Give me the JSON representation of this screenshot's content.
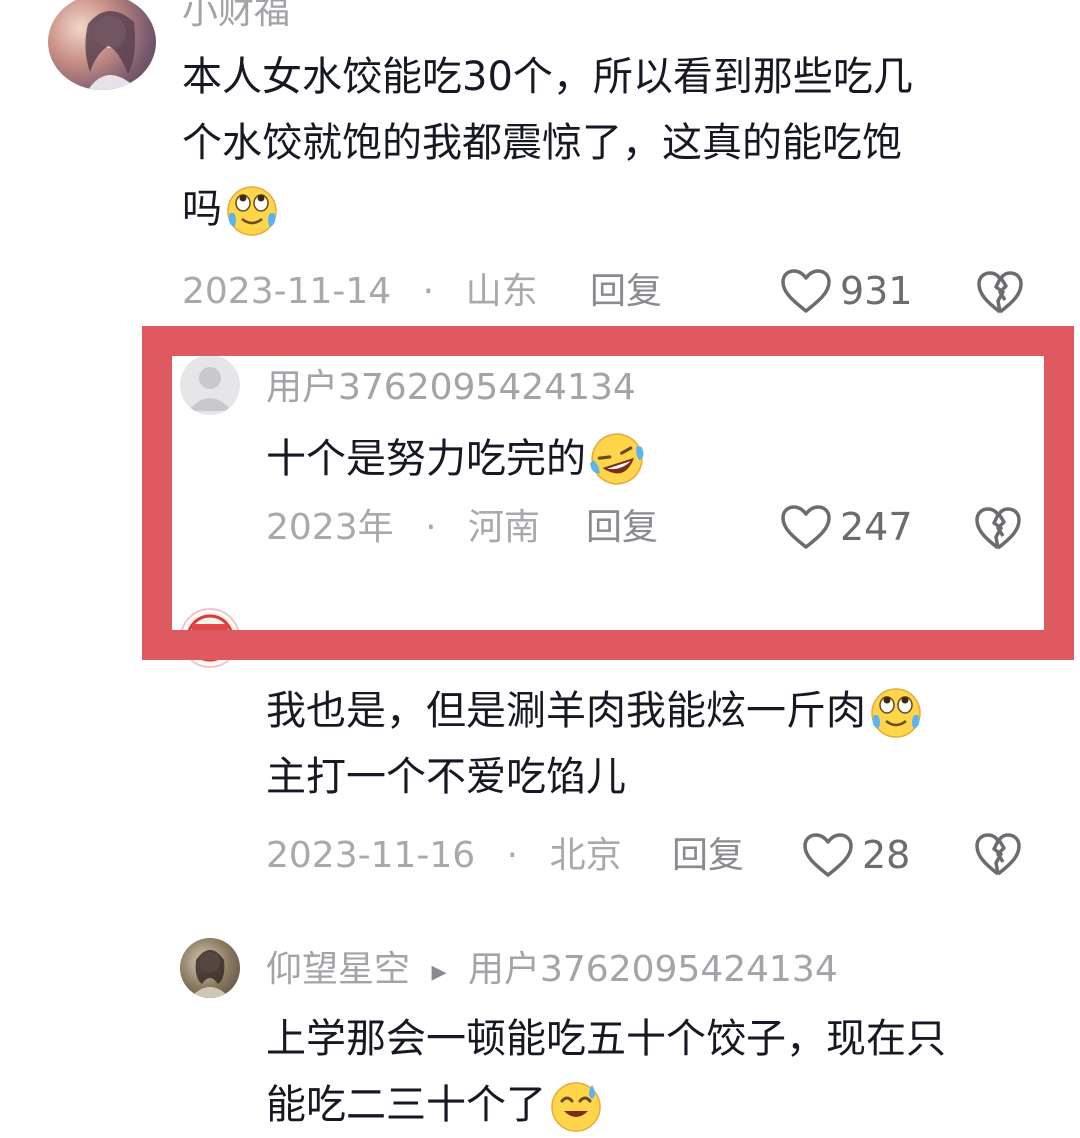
{
  "comments": [
    {
      "username": "小财福",
      "text": "本人女水饺能吃30个，所以看到那些吃几个水饺就饱的我都震惊了，这真的能吃饱吗",
      "line1": "本人女水饺能吃30个，所以看到那些吃几",
      "line2": "个水饺就饱的我都震惊了，这真的能吃饱",
      "line3": "吗",
      "emoji": "rolling-eyes-tears-emoji",
      "date": "2023-11-14",
      "separator": "·",
      "location": "山东",
      "reply_label": "回复",
      "likes": "931"
    },
    {
      "username": "用户3762095424134",
      "text": "十个是努力吃完的",
      "emoji": "laughing-tears-emoji",
      "date": "2023年",
      "separator": "·",
      "location": "河南",
      "reply_label": "回复",
      "likes": "247"
    },
    {
      "username_partial": "",
      "text": "我也是，但是涮羊肉我能炫一斤肉主打一个不爱吃馅儿",
      "line1": "我也是，但是涮羊肉我能炫一斤肉",
      "line2": "主打一个不爱吃馅儿",
      "emoji": "rolling-eyes-tears-emoji",
      "date": "2023-11-16",
      "separator": "·",
      "location": "北京",
      "reply_label": "回复",
      "likes": "28"
    },
    {
      "username": "仰望星空",
      "reply_arrow": "▸",
      "reply_to": "用户3762095424134",
      "line1": "上学那会一顿能吃五十个饺子，现在只",
      "line2": "能吃二三十个了",
      "emoji": "sweat-smile-emoji"
    }
  ],
  "colors": {
    "highlight_border": "#de5a60",
    "meta_text": "#a8a8ad",
    "body_text": "#161823"
  }
}
